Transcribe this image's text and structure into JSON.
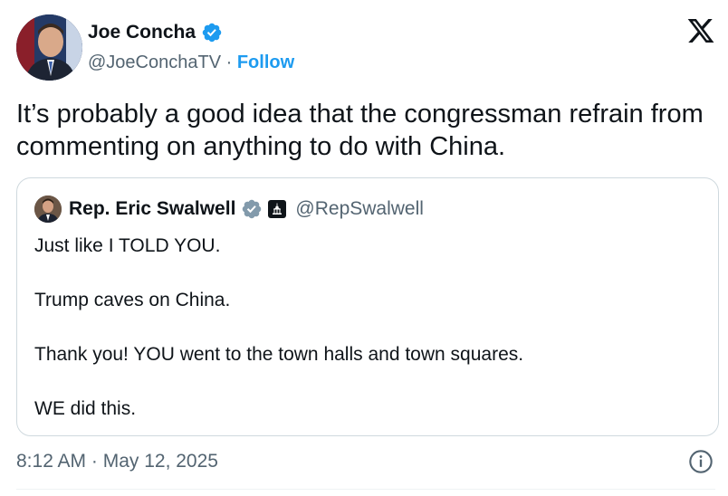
{
  "author": {
    "name": "Joe Concha",
    "handle": "@JoeConchaTV",
    "separator": " · ",
    "follow_label": "Follow",
    "verified": true,
    "avatar_icon": "avatar-photo"
  },
  "tweet": {
    "text": "It’s probably a good idea that the congressman refrain from commenting on anything to do with China."
  },
  "quoted_tweet": {
    "author_name": "Rep. Eric Swalwell",
    "handle": "@RepSwalwell",
    "verified": true,
    "badge_icon": "government-building-icon",
    "paragraphs": [
      "Just like I TOLD YOU.",
      "Trump caves on China.",
      "Thank you!  YOU went to the town halls and town squares.",
      "WE did this."
    ]
  },
  "timestamp": "8:12 AM · May 12, 2025",
  "colors": {
    "text": "#0f1419",
    "secondary": "#536471",
    "accent": "#1d9bf0",
    "border": "#cfd9de",
    "verified_blue": "#1d9bf0",
    "verified_gray": "#829aab"
  },
  "icons": [
    "verified-badge-icon",
    "x-logo-icon",
    "info-icon",
    "government-building-icon"
  ]
}
